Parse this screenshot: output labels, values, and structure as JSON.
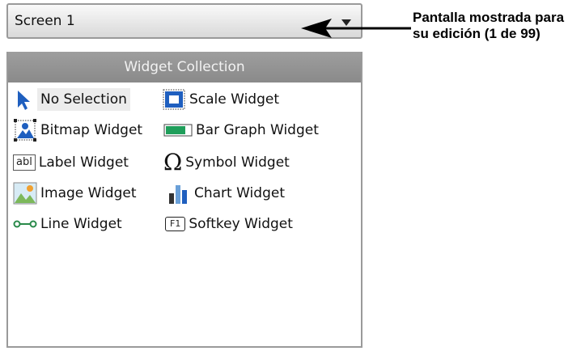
{
  "screen_select": {
    "value": "Screen 1"
  },
  "collection": {
    "title": "Widget Collection",
    "items": [
      {
        "id": "no-selection",
        "label": "No Selection",
        "icon": "pointer-arrow-icon",
        "selected": true
      },
      {
        "id": "scale",
        "label": "Scale Widget",
        "icon": "scale-icon"
      },
      {
        "id": "bitmap",
        "label": "Bitmap Widget",
        "icon": "bitmap-icon"
      },
      {
        "id": "bar-graph",
        "label": "Bar Graph Widget",
        "icon": "bar-graph-icon"
      },
      {
        "id": "label",
        "label": "Label Widget",
        "icon": "label-icon",
        "icon_text": "abl"
      },
      {
        "id": "symbol",
        "label": "Symbol Widget",
        "icon": "omega-icon",
        "icon_text": "Ω"
      },
      {
        "id": "image",
        "label": "Image Widget",
        "icon": "image-icon"
      },
      {
        "id": "chart",
        "label": "Chart Widget",
        "icon": "chart-icon"
      },
      {
        "id": "line",
        "label": "Line Widget",
        "icon": "line-icon"
      },
      {
        "id": "softkey",
        "label": "Softkey Widget",
        "icon": "softkey-icon",
        "icon_text": "F1"
      }
    ]
  },
  "annotation": {
    "line1": "Pantalla mostrada para",
    "line2": "su edición (1 de 99)"
  },
  "colors": {
    "accent_blue": "#1f5fbf",
    "header_gray": "#8f8f8f"
  }
}
